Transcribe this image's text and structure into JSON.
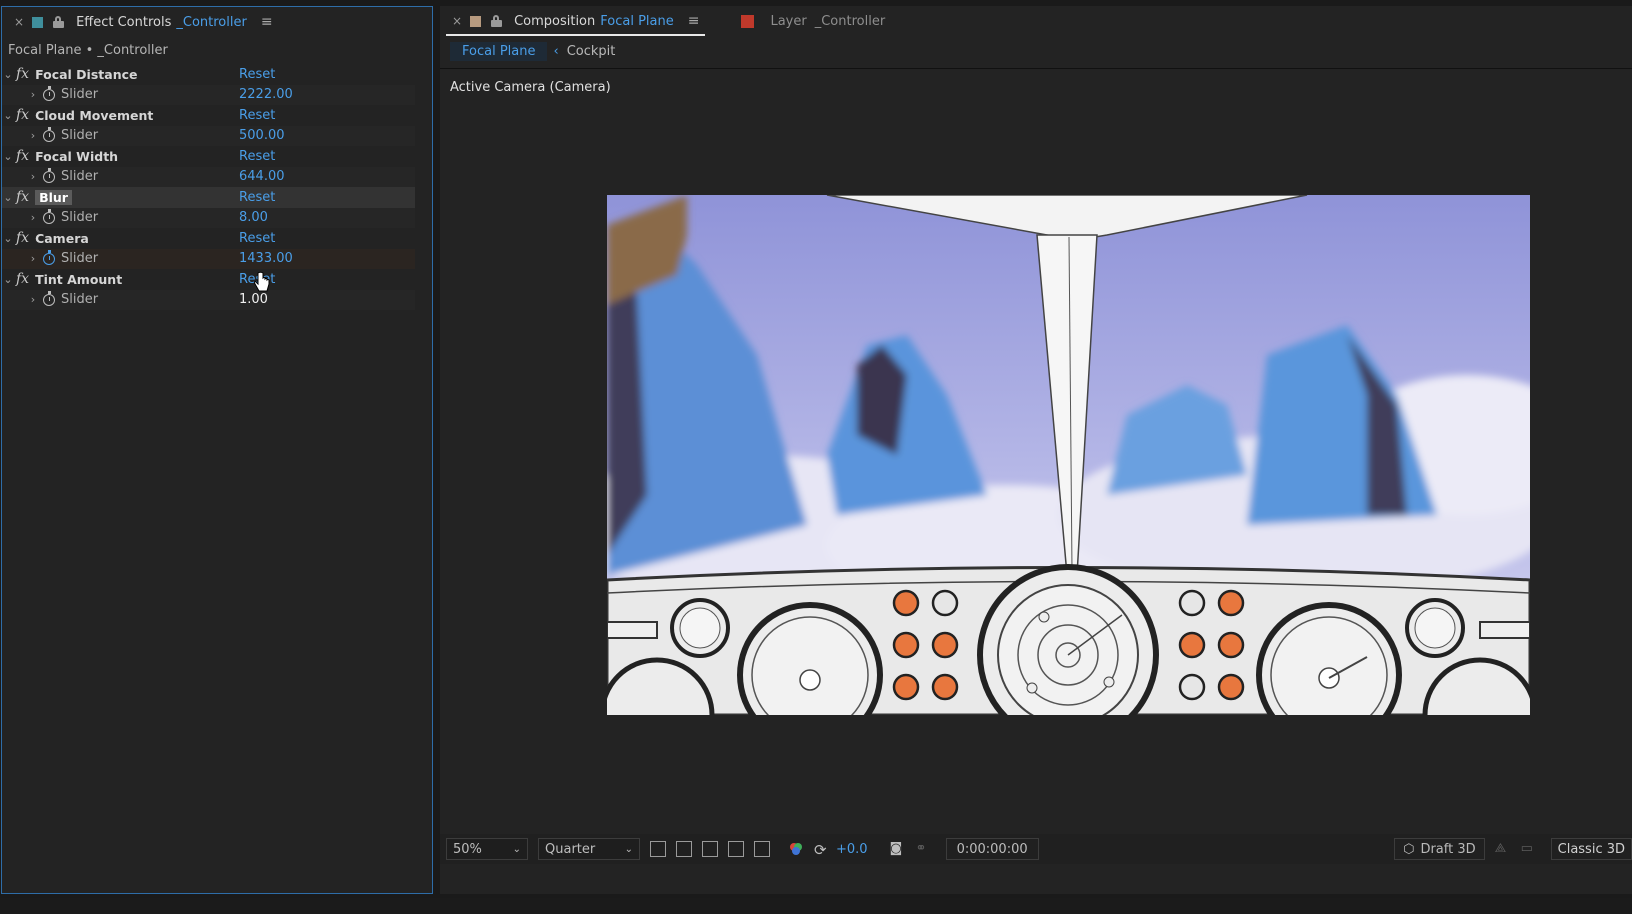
{
  "effect_controls": {
    "tab_title": "Effect Controls",
    "tab_layer": "_Controller",
    "breadcrumb": "Focal Plane • _Controller",
    "effects": [
      {
        "name": "Focal Distance",
        "reset": "Reset",
        "prop": "Slider",
        "value": "2222.00"
      },
      {
        "name": "Cloud Movement",
        "reset": "Reset",
        "prop": "Slider",
        "value": "500.00"
      },
      {
        "name": "Focal Width",
        "reset": "Reset",
        "prop": "Slider",
        "value": "644.00"
      },
      {
        "name": "Blur",
        "reset": "Reset",
        "prop": "Slider",
        "value": "8.00"
      },
      {
        "name": "Camera",
        "reset": "Reset",
        "prop": "Slider",
        "value": "1433.00"
      },
      {
        "name": "Tint Amount",
        "reset": "Reset",
        "prop": "Slider",
        "value": "1.00"
      }
    ]
  },
  "composition": {
    "tab_title": "Composition",
    "tab_name": "Focal Plane",
    "layer_tab_title": "Layer",
    "layer_tab_name": "_Controller",
    "view_tabs": [
      "Focal Plane",
      "Cockpit"
    ],
    "camera_label": "Active Camera (Camera)"
  },
  "footer": {
    "zoom": "50%",
    "resolution": "Quarter",
    "exposure": "+0.0",
    "timecode": "0:00:00:00",
    "renderer": "Draft 3D",
    "classic": "Classic 3D"
  },
  "colors": {
    "accent": "#4a9ee8",
    "ec_swatch": "#3f8f9c",
    "comp_swatch": "#b79a7f",
    "layer_swatch": "#c0392b"
  }
}
